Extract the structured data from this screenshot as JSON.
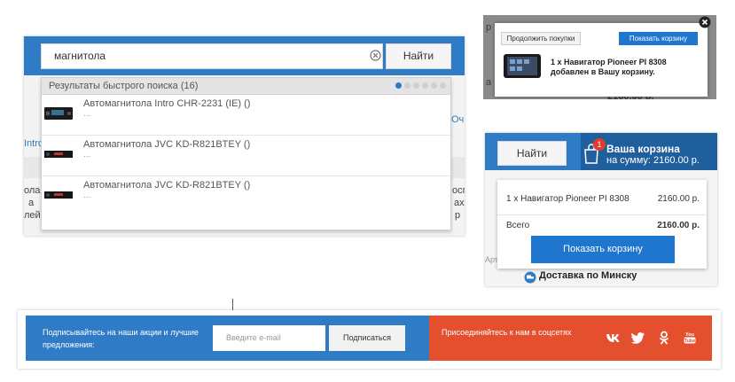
{
  "quick_search": {
    "query": "магнитола",
    "find_label": "Найти",
    "results_title": "Результаты быстрого поиска (16)",
    "pages": [
      true,
      false,
      false,
      false,
      false,
      false
    ],
    "results": [
      {
        "name": "Автомагнитола Intro CHR-2231 (IE) ()",
        "sub": "..."
      },
      {
        "name": "Автомагнитола JVC KD-R821BTEY ()",
        "sub": "..."
      },
      {
        "name": "Автомагнитола JVC KD-R821BTEY ()",
        "sub": "..."
      }
    ],
    "background": {
      "left_fragment_1": "Intro",
      "right_fragment_1": "Очи",
      "left_fragment_2": "ола",
      "left_fragment_3": "а",
      "left_fragment_4": "лей",
      "right_fragment_2": "осп",
      "right_fragment_3": "ах",
      "right_fragment_4": "р"
    }
  },
  "add_to_cart_popup": {
    "continue_label": "Продолжить покупки",
    "show_cart_label": "Показать корзину",
    "message_line1": "1 x Навигатор Pioneer PI 8308",
    "message_line2": "добавлен в Вашу корзину.",
    "background_price": "2160.00 р.",
    "background_fragment_1": "р",
    "background_fragment_2": "а"
  },
  "cart": {
    "find_label": "Найти",
    "badge_count": "1",
    "title": "Ваша корзина",
    "sum_text": "на сумму:  2160.00 р.",
    "item_name": "1 x Навигатор Pioneer PI 8308",
    "item_price": "2160.00 р.",
    "total_label": "Всего",
    "total_value": "2160.00 р.",
    "show_cart_label": "Показать корзину",
    "side_fragment": "Арт.",
    "delivery_label": "Доставка по Минску"
  },
  "footer": {
    "subscribe_text": "Подписывайтесь на наши акции и лучшие предложения:",
    "email_placeholder": "Введите e-mail",
    "subscribe_button": "Подписаться",
    "social_text": "Присоединяйтесь к нам в соцсетях",
    "social_icons": [
      "vk-icon",
      "twitter-icon",
      "odnoklassniki-icon",
      "youtube-icon"
    ]
  },
  "colors": {
    "brand_blue": "#2f7bc5",
    "button_blue": "#1f76cf",
    "social_orange": "#e4502e",
    "badge_red": "#e23b2e"
  }
}
